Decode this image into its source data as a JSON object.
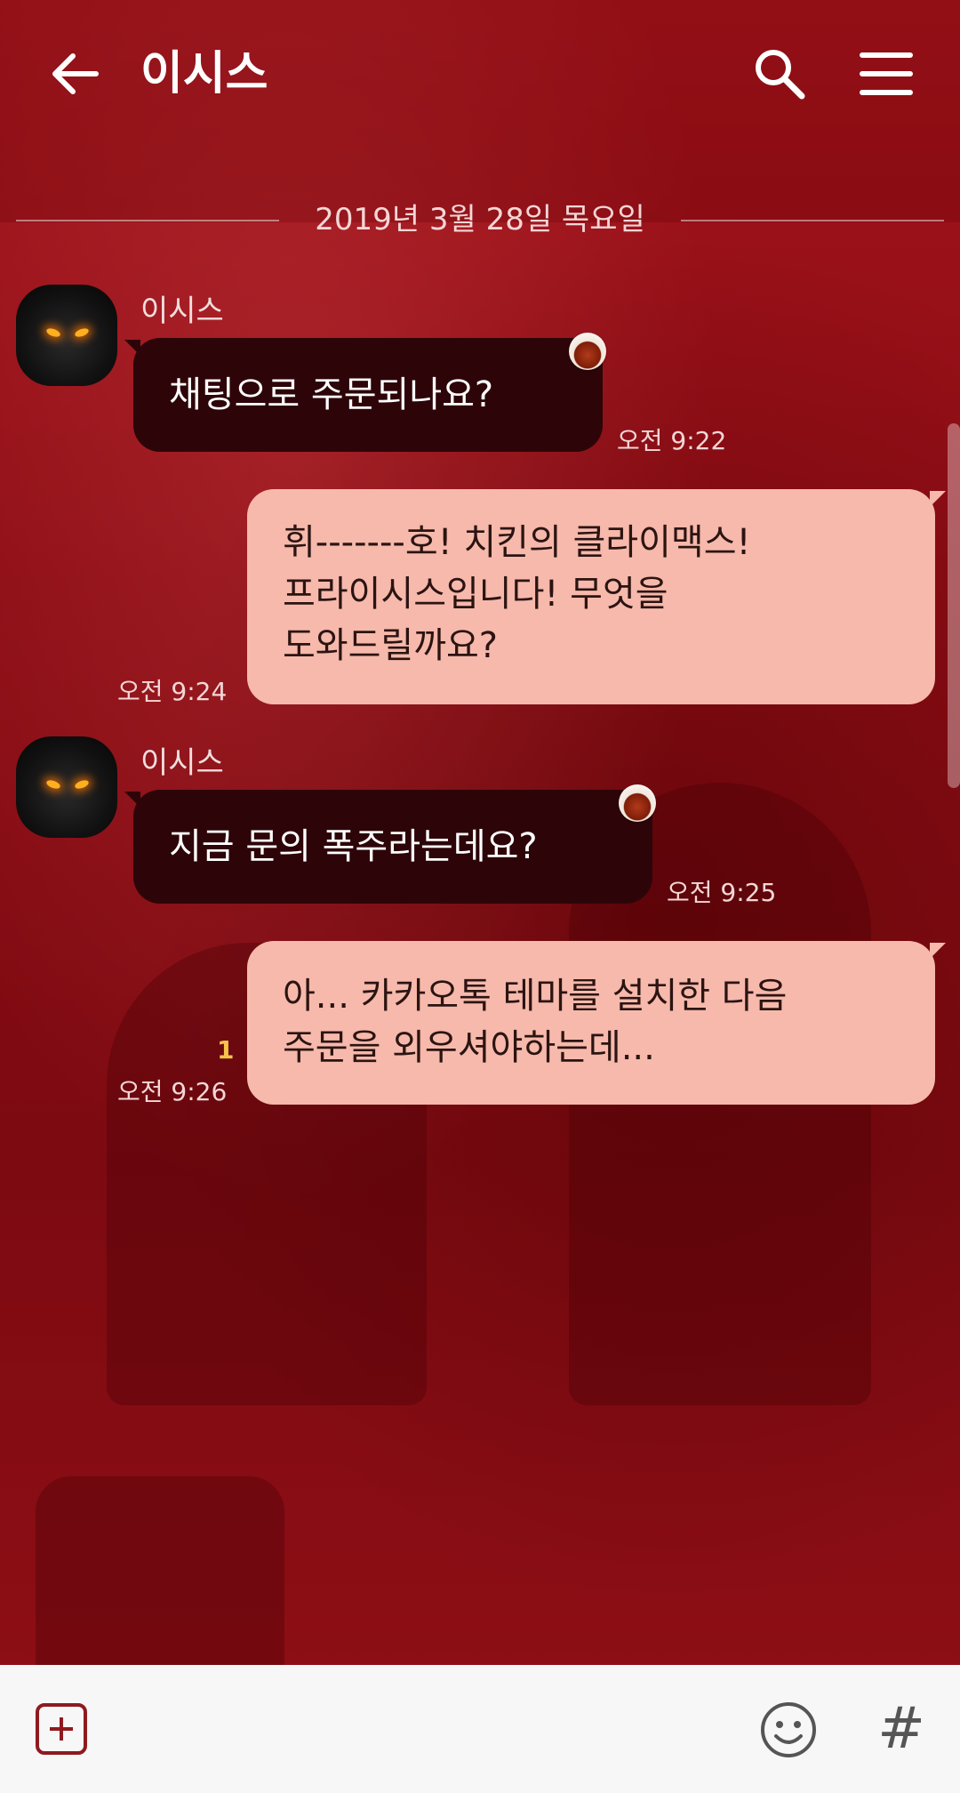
{
  "header": {
    "title": "이시스",
    "back_icon": "arrow-left-icon",
    "search_icon": "search-icon",
    "menu_icon": "hamburger-menu-icon"
  },
  "chat": {
    "date": "2019년 3월 28일 목요일",
    "messages": [
      {
        "direction": "in",
        "sender": "이시스",
        "lines": [
          "채팅으로 주문되나요?"
        ],
        "time": "오전 9:22"
      },
      {
        "direction": "out",
        "lines": [
          "휘-------호! 치킨의 클라이맥스!",
          "프라이시스입니다! 무엇을",
          "도와드릴까요?"
        ],
        "time": "오전 9:24"
      },
      {
        "direction": "in",
        "sender": "이시스",
        "lines": [
          "지금 문의 폭주라는데요?"
        ],
        "time": "오전 9:25"
      },
      {
        "direction": "out",
        "lines": [
          "아... 카카오톡 테마를 설치한 다음",
          "주문을 외우셔야하는데..."
        ],
        "time": "오전 9:26",
        "unread": "1"
      }
    ]
  },
  "input_bar": {
    "plus_icon": "plus-box-icon",
    "emoji_icon": "smiley-icon",
    "hash_label": "#"
  },
  "colors": {
    "background": "#8e0b12",
    "incoming_bubble": "#2d0508",
    "outgoing_bubble": "#f6b9ab",
    "unread": "#f5c34a",
    "accent": "#8e1a1f"
  }
}
